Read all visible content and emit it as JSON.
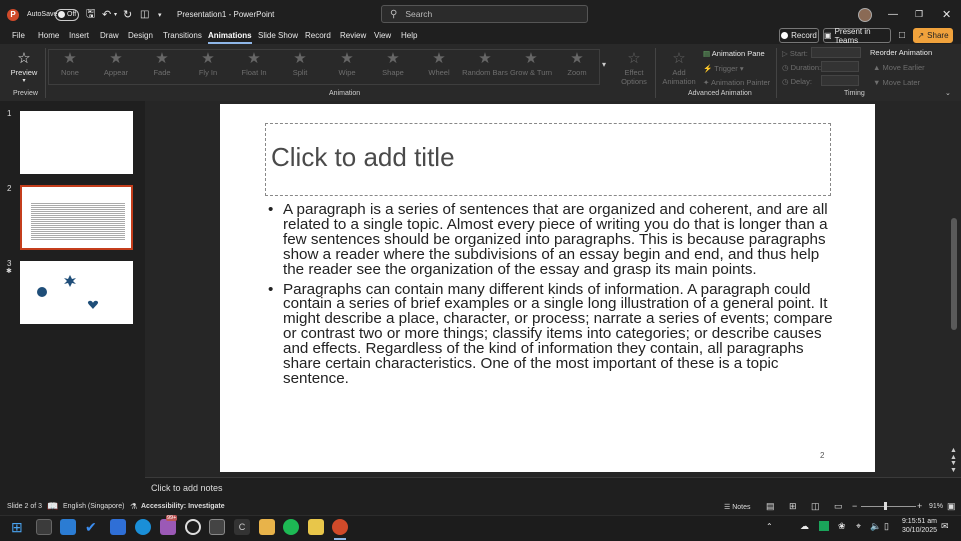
{
  "titlebar": {
    "autosave_label": "AutoSave",
    "autosave_state": "Off",
    "doc_title": "Presentation1 - PowerPoint",
    "search_placeholder": "Search"
  },
  "menu": {
    "items": [
      "File",
      "Home",
      "Insert",
      "Draw",
      "Design",
      "Transitions",
      "Animations",
      "Slide Show",
      "Record",
      "Review",
      "View",
      "Help"
    ],
    "active": "Animations"
  },
  "top_buttons": {
    "record": "Record",
    "present_in_teams": "Present in Teams",
    "share": "Share"
  },
  "ribbon": {
    "preview_label": "Preview",
    "animations": [
      "None",
      "Appear",
      "Fade",
      "Fly In",
      "Float In",
      "Split",
      "Wipe",
      "Shape",
      "Wheel",
      "Random Bars",
      "Grow & Turn",
      "Zoom"
    ],
    "effect_options": "Effect Options",
    "add_animation": "Add Animation",
    "animation_pane": "Animation Pane",
    "trigger": "Trigger",
    "animation_painter": "Animation Painter",
    "start_label": "Start:",
    "duration_label": "Duration:",
    "delay_label": "Delay:",
    "reorder_animation": "Reorder Animation",
    "move_earlier": "Move Earlier",
    "move_later": "Move Later",
    "groups": {
      "preview": "Preview",
      "animation": "Animation",
      "advanced": "Advanced Animation",
      "timing": "Timing"
    }
  },
  "thumbnails": {
    "numbers": [
      "1",
      "2",
      "3"
    ],
    "selected": "2"
  },
  "slide": {
    "title_placeholder": "Click to add title",
    "bullets": [
      "A paragraph is a series of sentences that are organized and coherent, and are all related to a single topic. Almost every piece of writing you do that is longer than a few sentences should be organized into paragraphs. This is because paragraphs show a reader where the subdivisions of an essay begin and end, and thus help the reader see the organization of the essay and grasp its main points.",
      "Paragraphs can contain many different kinds of information. A paragraph could contain a series of brief examples or a single long illustration of a general point. It might describe a place, character, or process; narrate a series of events; compare or contrast two or more things; classify items into categories; or describe causes and effects. Regardless of the kind of information they contain, all paragraphs share certain characteristics. One of the most important of these is a topic sentence."
    ],
    "number": "2"
  },
  "notes_placeholder": "Click to add notes",
  "status": {
    "slide_of": "Slide 2 of 3",
    "language": "English (Singapore)",
    "accessibility": "Accessibility: Investigate",
    "notes": "Notes",
    "zoom": "91%"
  },
  "taskbar": {
    "badge": "99+",
    "time": "9:15:51 am",
    "date": "30/10/2025"
  },
  "colors": {
    "accent": "#8fb7e8",
    "share": "#f0a23c",
    "shape_fill": "#1f4e79"
  }
}
